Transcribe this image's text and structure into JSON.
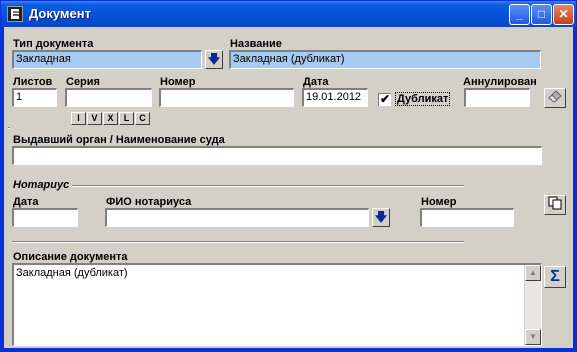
{
  "window": {
    "title": "Документ"
  },
  "doc_type": {
    "label": "Тип документа",
    "value": "Закладная"
  },
  "name": {
    "label": "Название",
    "value": "Закладная (дубликат)"
  },
  "sheets": {
    "label": "Листов",
    "value": "1"
  },
  "series": {
    "label": "Серия",
    "value": "",
    "roman_buttons": [
      "I",
      "V",
      "X",
      "L",
      "C"
    ]
  },
  "number": {
    "label": "Номер",
    "value": ""
  },
  "date": {
    "label": "Дата",
    "value": "19.01.2012"
  },
  "duplicate": {
    "label": "Дубликат",
    "checked": true,
    "mark": "✔"
  },
  "annulled": {
    "label": "Аннулирован",
    "value": ""
  },
  "issuer": {
    "label": "Выдавший орган / Наименование суда",
    "value": ""
  },
  "notary": {
    "section_label": "Нотариус",
    "date_label": "Дата",
    "date_value": "",
    "fio_label": "ФИО нотариуса",
    "fio_value": "",
    "number_label": "Номер",
    "number_value": ""
  },
  "description": {
    "label": "Описание документа",
    "value": "Закладная (дубликат)"
  },
  "sum_button": "Σ"
}
